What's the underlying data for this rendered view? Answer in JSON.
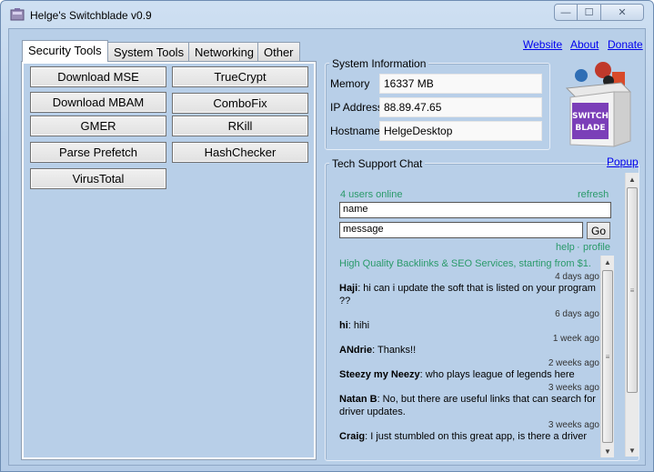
{
  "window": {
    "title": "Helge's Switchblade v0.9",
    "min_glyph": "—",
    "max_glyph": "☐",
    "close_glyph": "✕"
  },
  "tabs": [
    {
      "label": "Security Tools",
      "active": true
    },
    {
      "label": "System Tools",
      "active": false
    },
    {
      "label": "Networking",
      "active": false
    },
    {
      "label": "Other",
      "active": false
    }
  ],
  "security_tools": {
    "download_mse": "Download MSE",
    "truecrypt": "TrueCrypt",
    "download_mbam": "Download MBAM",
    "combofix": "ComboFix",
    "gmer": "GMER",
    "rkill": "RKill",
    "parse_prefetch": "Parse Prefetch",
    "hashchecker": "HashChecker",
    "virustotal": "VirusTotal"
  },
  "links": {
    "website": "Website",
    "about": "About",
    "donate": "Donate",
    "popup": "Popup"
  },
  "system_info": {
    "title": "System Information",
    "memory_label": "Memory",
    "memory_value": "16337 MB",
    "ip_label": "IP Address",
    "ip_value": "88.89.47.65",
    "hostname_label": "Hostname",
    "hostname_value": "HelgeDesktop"
  },
  "logo": {
    "text_line1": "SWITCH",
    "text_line2": "BLADE"
  },
  "chat": {
    "title": "Tech Support Chat",
    "users_online": "4 users online",
    "refresh": "refresh",
    "name_value": "name",
    "message_value": "message",
    "go_label": "Go",
    "help": "help",
    "separator": "·",
    "profile": "profile",
    "spam_line": "High Quality Backlinks & SEO Services, starting from $1.",
    "messages": [
      {
        "time": "4 days ago",
        "user": "Haji",
        "text": ": hi can i update the soft that is listed on your program ??"
      },
      {
        "time": "6 days ago",
        "user": "hi",
        "text": ": hihi"
      },
      {
        "time": "1 week ago",
        "user": "ANdrie",
        "text": ": Thanks!!"
      },
      {
        "time": "2 weeks ago",
        "user": "Steezy my Neezy",
        "text": ": who plays league of legends here"
      },
      {
        "time": "3 weeks ago",
        "user": "Natan B",
        "text": ": No, but there are useful links that can search for driver updates."
      },
      {
        "time": "3 weeks ago",
        "user": "Craig",
        "text": ": I just stumbled on this great app, is there a driver"
      }
    ],
    "scroll_up": "▲",
    "scroll_down": "▼",
    "grip": "≡"
  }
}
